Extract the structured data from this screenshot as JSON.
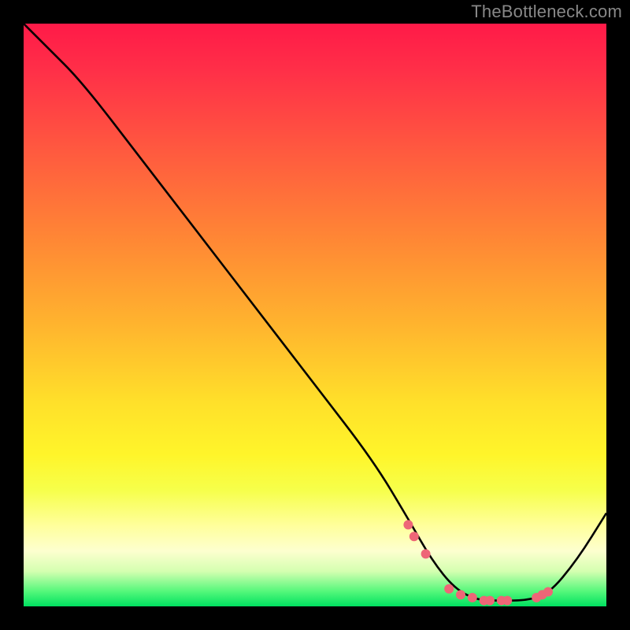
{
  "watermark": "TheBottleneck.com",
  "chart_data": {
    "type": "line",
    "title": "",
    "xlabel": "",
    "ylabel": "",
    "xlim": [
      0,
      100
    ],
    "ylim": [
      0,
      100
    ],
    "series": [
      {
        "name": "curve",
        "x": [
          0,
          4,
          10,
          20,
          30,
          40,
          50,
          60,
          66,
          70,
          74,
          78,
          82,
          86,
          90,
          95,
          100
        ],
        "y": [
          100,
          96,
          90,
          77,
          64,
          51,
          38,
          25,
          15,
          8,
          3,
          1,
          1,
          1,
          2,
          8,
          16
        ]
      },
      {
        "name": "dots",
        "x": [
          66,
          67,
          69,
          73,
          75,
          77,
          79,
          80,
          82,
          83,
          88,
          89,
          90
        ],
        "y": [
          14,
          12,
          9,
          3,
          2,
          1.5,
          1,
          1,
          1,
          1,
          1.5,
          2,
          2.5
        ]
      }
    ],
    "colors": {
      "curve": "#000000",
      "dots": "#ee6677",
      "gradient_top": "#ff1a48",
      "gradient_mid": "#ffe02a",
      "gradient_bottom": "#00e060"
    }
  }
}
